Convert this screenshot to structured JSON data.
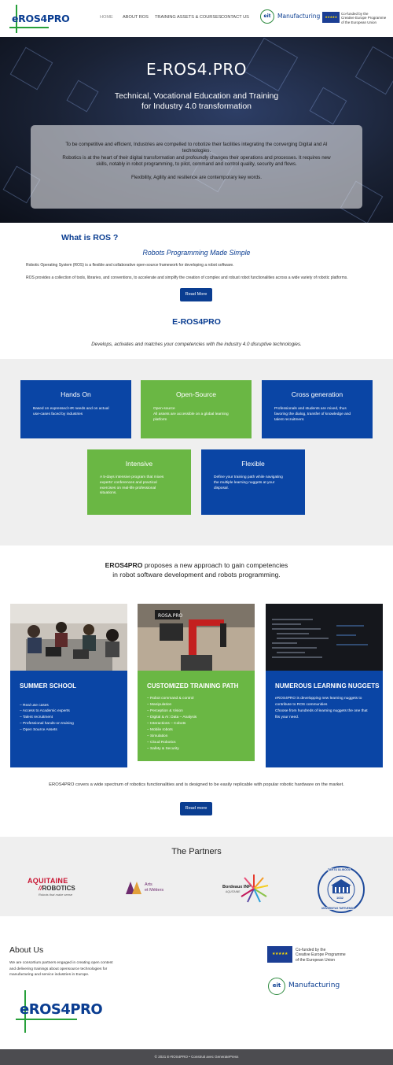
{
  "header": {
    "logo_text": "eROS4PRO",
    "nav": [
      "HOME",
      "ABOUT ROS",
      "TRAINING ASSETS & COURSES",
      "CONTACT US"
    ],
    "eit_label": "Manufacturing",
    "eu_text": [
      "Co-funded by the",
      "Creative Europe Programme",
      "of the European Union"
    ]
  },
  "hero": {
    "title": "E-ROS4.PRO",
    "subtitle_1": "Technical, Vocational Education and Training",
    "subtitle_2": "for Industry 4.0 transformation",
    "box_lines": [
      "To be competitive and efficient, Industries are compelled to robotize their facilities integrating the converging Digital and AI",
      "technologies.",
      "Robotics is at the heart of their digital transformation and profoundly changes their operations and processes. It requires new",
      "skills, notably in robot programming, to pilot, command and control quality, security and flows.",
      "Flexibility, Agility and resilience are contemporary key words."
    ]
  },
  "what_ros": {
    "heading": "What is ROS ?",
    "tagline": "Robots Programming Made Simple",
    "para_1": "Robotic Operating System (ROS) is a flexible and collaborative open-source framework for developing a robot software.",
    "para_2": "ROS provides a collection of tools, libraries, and conventions, to accelerate and simplify the creation of complex and robust robot functionalities across a wide variety of robotic platforms.",
    "button": "Read More"
  },
  "eros": {
    "heading": "E-ROS4PRO",
    "text": "Develops, activates and matches your competencies with the industry 4.0 disruptive technologies."
  },
  "features": [
    {
      "title": "Hands On",
      "lines": [
        "Based on expressed HR needs and on actual",
        "use-cases faced by industries"
      ]
    },
    {
      "title": "Open-Source",
      "lines": [
        "Open-source",
        "All assets are accessible on a global learning",
        "platform"
      ]
    },
    {
      "title": "Cross generation",
      "lines": [
        "Professionals and students are mixed, thus",
        "favoring the dialog, transfer of knowledge and",
        "talent recruitment."
      ]
    },
    {
      "title": "Intensive",
      "lines": [
        "A 5-days intensive program that mixes",
        "experts' conferences and practical",
        "exercises on real-life professional",
        "situations."
      ]
    },
    {
      "title": "Flexible",
      "lines": [
        "Define your training path while navigating",
        "the multiple learning nuggets at your",
        "disposal."
      ]
    }
  ],
  "proposes": {
    "brand": "EROS4PRO",
    "line_1_rest": " proposes a new approach to gain competencies",
    "line_2": "in robot software development and robots programming."
  },
  "programs": [
    {
      "title": "SUMMER SCHOOL",
      "items": [
        "– Real use cases",
        "– Access to Academic experts",
        "– Talent recruitment",
        "– Professional hands-on training",
        "– Open Source Assets"
      ]
    },
    {
      "title": "CUSTOMIZED TRAINING PATH",
      "items": [
        "– Robot command & control",
        "– Manipulation",
        "– Perception & Vision",
        "– Digital & AI: Data – Analysis",
        "– Interactions – Cobots",
        "– Mobile robots",
        "– Simulation",
        "– Cloud Robotics",
        "– Safety & Security"
      ]
    },
    {
      "title": "NUMEROUS LEARNING NUGGETS",
      "items": [
        "eROS4PRO is developping new learning nuggets to",
        "contribute to ROS communities",
        "Choose from hundreds of learning nuggets the one that",
        "fits your need."
      ]
    }
  ],
  "covers_text": "EROS4PRO covers a wide spectrum of robotics functionalities and is designed to be easily replicable with popular robotic hardware on the market.",
  "read_more_2": "Read more",
  "partners": {
    "title": "The Partners",
    "aquitaine": [
      "AQUITAINE",
      "ROBOTICS",
      "Robots that make sense"
    ],
    "arts": [
      "Arts",
      "et Métiers"
    ],
    "bordeaux": [
      "Bordeaux INP",
      "AQUITAINE"
    ],
    "tartu": [
      "TARTU ÜLIKOOL",
      "UNIVERSITAS TARTUENSIS",
      "1632"
    ]
  },
  "about": {
    "title": "About Us",
    "lines": [
      "We are consortium partners engaged in creating open content",
      "and delivering trainings about opensource technologies for",
      "manufacturing and service industries in Europe."
    ],
    "logo_text": "eROS4PRO"
  },
  "footer": "© 2021 E-ROS4PRO • Construit avec GeneratePress",
  "colors": {
    "brand_blue": "#0a45a5",
    "brand_green": "#6ab744",
    "footer_bg": "#4c4c50"
  }
}
